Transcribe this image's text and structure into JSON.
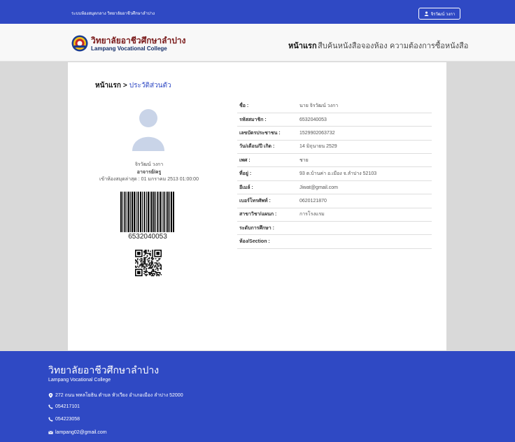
{
  "topbar": {
    "title": "ระบบห้องสมุดกลาง วิทยาลัยอาชีวศึกษาลำปาง",
    "user_label": "จิรวัฒน์ วงกา",
    "user_icon": "user-icon"
  },
  "brand": {
    "name_th": "วิทยาลัยอาชีวศึกษาลำปาง",
    "name_en": "Lampang Vocational College",
    "logo_icon": "college-seal-logo"
  },
  "nav": {
    "home": "หน้าแรก",
    "search": "สืบค้นหนังสือ",
    "booking": "จองห้อง",
    "request": "ความต้องการซื้อหนังสือ"
  },
  "breadcrumb": {
    "home": "หน้าแรก",
    "separator": ">",
    "current": "ประวัติส่วนตัว"
  },
  "profile": {
    "name": "จิรวัฒน์ วงกา",
    "role": "อาจารย์/ครู",
    "last_visit": "เข้าห้องสมุดล่าสุด : 01 มกราคม 2513 01:00:00",
    "barcode_number": "6532040053"
  },
  "details": [
    {
      "label": "ชื่อ :",
      "value": "นาย จิรวัฒน์ วงกา"
    },
    {
      "label": "รหัสสมาชิก :",
      "value": "6532040053"
    },
    {
      "label": "เลขบัตรประชาชน :",
      "value": "1529902063732"
    },
    {
      "label": "วัน/เดือน/ปี เกิด :",
      "value": "14 มิถุนายน 2529"
    },
    {
      "label": "เพศ :",
      "value": "ชาย"
    },
    {
      "label": "ที่อยู่ :",
      "value": "93 ต.บ้านค่า อ.เมือง จ.ลำปาง 52103"
    },
    {
      "label": "อีเมล์ :",
      "value": "Jiwat@gmail.com"
    },
    {
      "label": "เบอร์โทรศัพท์ :",
      "value": "0620121870"
    },
    {
      "label": "สาขาวิชา/แผนก :",
      "value": "การโรงแรม"
    },
    {
      "label": "ระดับการศึกษา :",
      "value": ""
    },
    {
      "label": "ห้อง/Section :",
      "value": ""
    }
  ],
  "footer": {
    "title": "วิทยาลัยอาชีวศึกษาลำปาง",
    "subtitle": "Lampang Vocational College",
    "address": "272 ถนน พหลโยธิน ตำบล หัวเวียง อำเภอเมือง ลำปาง 52000",
    "phone1": "054217101",
    "phone2": "054223058",
    "email": "lampang02@gmail.com"
  },
  "colors": {
    "primary": "#2f49c4",
    "brand_text": "#7a1a1a",
    "link": "#2f49c4"
  }
}
